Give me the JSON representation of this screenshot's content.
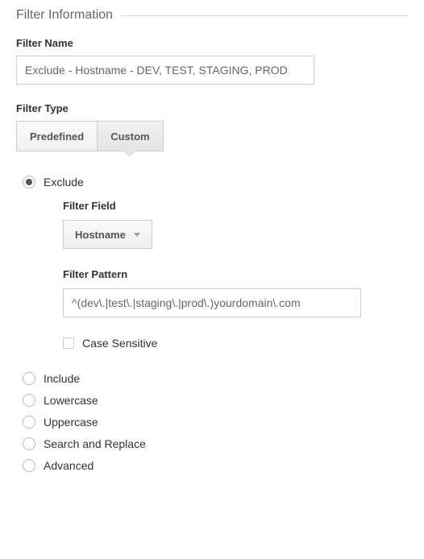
{
  "section": {
    "title": "Filter Information"
  },
  "filterName": {
    "label": "Filter Name",
    "value": "Exclude - Hostname - DEV, TEST, STAGING, PROD"
  },
  "filterType": {
    "label": "Filter Type",
    "tabs": {
      "predefined": "Predefined",
      "custom": "Custom"
    },
    "active": "custom"
  },
  "customOptions": {
    "exclude": "Exclude",
    "include": "Include",
    "lowercase": "Lowercase",
    "uppercase": "Uppercase",
    "searchReplace": "Search and Replace",
    "advanced": "Advanced",
    "selected": "exclude"
  },
  "filterField": {
    "label": "Filter Field",
    "value": "Hostname"
  },
  "filterPattern": {
    "label": "Filter Pattern",
    "value": "^(dev\\.|test\\.|staging\\.|prod\\.)yourdomain\\.com"
  },
  "caseSensitive": {
    "label": "Case Sensitive",
    "checked": false
  }
}
